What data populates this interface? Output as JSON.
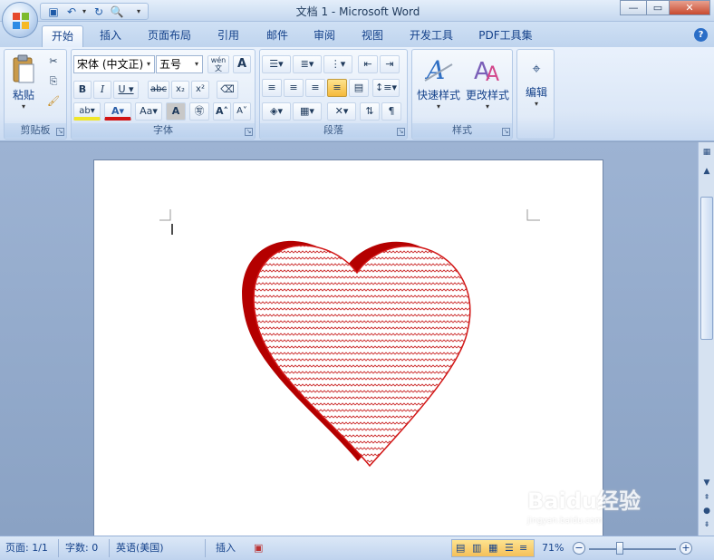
{
  "window": {
    "title": "文档 1 - Microsoft Word"
  },
  "tabs": [
    "开始",
    "插入",
    "页面布局",
    "引用",
    "邮件",
    "审阅",
    "视图",
    "开发工具",
    "PDF工具集"
  ],
  "active_tab": "开始",
  "ribbon": {
    "clipboard": {
      "label": "剪贴板",
      "paste_label": "粘贴"
    },
    "font": {
      "label": "字体",
      "font_name": "宋体 (中文正)",
      "font_size": "五号",
      "phonetic_glyph": "wén\n文"
    },
    "paragraph": {
      "label": "段落"
    },
    "styles": {
      "label": "样式",
      "quick_styles": "快速样式",
      "change_styles": "更改样式"
    },
    "editing": {
      "label": "编辑",
      "edit_label": "编辑"
    }
  },
  "status": {
    "page": "页面: 1/1",
    "words": "字数: 0",
    "language": "英语(美国)",
    "mode": "插入",
    "zoom": "71%"
  },
  "watermark": {
    "text": "Baidu经验",
    "sub": "jingyan.baidu.com"
  },
  "colors": {
    "accent": "#15428b",
    "heart_dark": "#b40000",
    "heart_edge": "#d21414",
    "pattern": "#cc3030"
  }
}
